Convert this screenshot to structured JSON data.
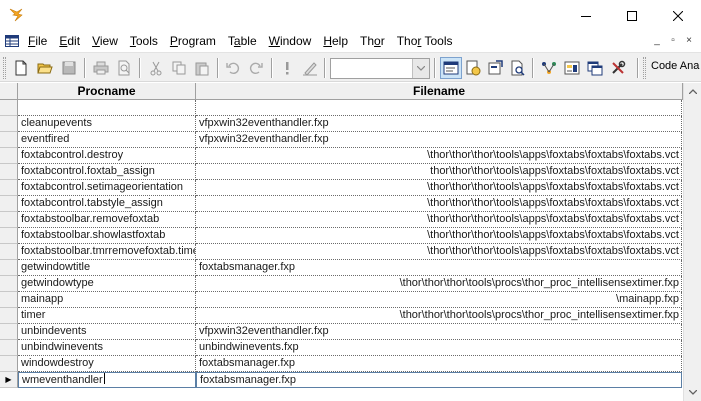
{
  "window": {
    "title": "",
    "minimize_icon": "minimize-icon",
    "maximize_icon": "maximize-icon",
    "close_icon": "close-icon"
  },
  "menu": {
    "items": [
      {
        "label": "File",
        "accel": "F"
      },
      {
        "label": "Edit",
        "accel": "E"
      },
      {
        "label": "View",
        "accel": "V"
      },
      {
        "label": "Tools",
        "accel": "T"
      },
      {
        "label": "Program",
        "accel": "P"
      },
      {
        "label": "Table",
        "accel": "a"
      },
      {
        "label": "Window",
        "accel": "W"
      },
      {
        "label": "Help",
        "accel": "H"
      },
      {
        "label": "Thor",
        "accel": "o"
      },
      {
        "label": "Thor Tools",
        "accel": "r"
      }
    ],
    "mdi_minimize": "_",
    "mdi_restore": "▫",
    "mdi_close": "×"
  },
  "toolbar": {
    "combo_value": "",
    "code_analysis_label": "Code Ana"
  },
  "grid": {
    "columns": [
      "Procname",
      "Filename"
    ],
    "rows": [
      {
        "procname": "",
        "filename": "",
        "align": "left"
      },
      {
        "procname": "cleanupevents",
        "filename": "vfpxwin32eventhandler.fxp",
        "align": "left"
      },
      {
        "procname": "eventfired",
        "filename": "vfpxwin32eventhandler.fxp",
        "align": "left"
      },
      {
        "procname": "foxtabcontrol.destroy",
        "filename": "\\thor\\thor\\thor\\tools\\apps\\foxtabs\\foxtabs\\foxtabs.vct",
        "align": "right"
      },
      {
        "procname": "foxtabcontrol.foxtab_assign",
        "filename": "thor\\thor\\thor\\tools\\apps\\foxtabs\\foxtabs\\foxtabs.vct",
        "align": "right"
      },
      {
        "procname": "foxtabcontrol.setimageorientation",
        "filename": "\\thor\\thor\\thor\\tools\\apps\\foxtabs\\foxtabs\\foxtabs.vct",
        "align": "right"
      },
      {
        "procname": "foxtabcontrol.tabstyle_assign",
        "filename": "\\thor\\thor\\thor\\tools\\apps\\foxtabs\\foxtabs\\foxtabs.vct",
        "align": "right"
      },
      {
        "procname": "foxtabstoolbar.removefoxtab",
        "filename": "\\thor\\thor\\thor\\tools\\apps\\foxtabs\\foxtabs\\foxtabs.vct",
        "align": "right"
      },
      {
        "procname": "foxtabstoolbar.showlastfoxtab",
        "filename": "\\thor\\thor\\thor\\tools\\apps\\foxtabs\\foxtabs\\foxtabs.vct",
        "align": "right"
      },
      {
        "procname": "foxtabstoolbar.tmrremovefoxtab.timer",
        "filename": "\\thor\\thor\\thor\\tools\\apps\\foxtabs\\foxtabs\\foxtabs.vct",
        "align": "right"
      },
      {
        "procname": "getwindowtitle",
        "filename": "foxtabsmanager.fxp",
        "align": "left"
      },
      {
        "procname": "getwindowtype",
        "filename": "\\thor\\thor\\thor\\tools\\procs\\thor_proc_intellisensextimer.fxp",
        "align": "right"
      },
      {
        "procname": "mainapp",
        "filename": "\\mainapp.fxp",
        "align": "right"
      },
      {
        "procname": "timer",
        "filename": "\\thor\\thor\\thor\\tools\\procs\\thor_proc_intellisensextimer.fxp",
        "align": "right"
      },
      {
        "procname": "unbindevents",
        "filename": "vfpxwin32eventhandler.fxp",
        "align": "left"
      },
      {
        "procname": "unbindwinevents",
        "filename": "unbindwinevents.fxp",
        "align": "left"
      },
      {
        "procname": "windowdestroy",
        "filename": "foxtabsmanager.fxp",
        "align": "left"
      },
      {
        "procname": "wmeventhandler",
        "filename": "foxtabsmanager.fxp",
        "align": "left"
      }
    ],
    "active_row": 17,
    "row_pointer": "▶"
  },
  "colors": {
    "toolbar_bg": "#f0f0f0",
    "header_bg": "#f0f0f0",
    "grid_line": "#6a6a6a",
    "active_border": "#5b7fa5",
    "app_icon": "#f5a623"
  }
}
